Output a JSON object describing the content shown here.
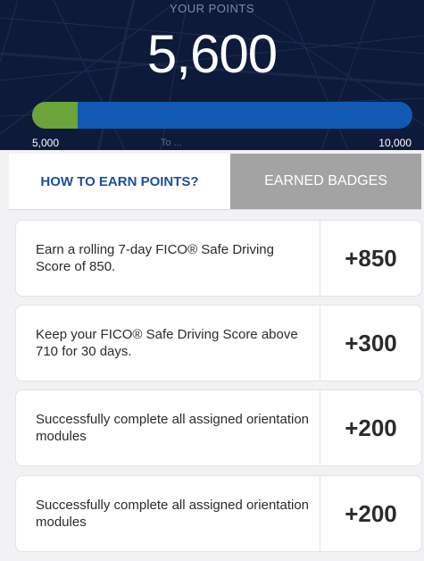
{
  "header": {
    "points_label": "YOUR POINTS",
    "points_value": "5,600",
    "progress": {
      "current": 5600,
      "min": 5000,
      "max": 10000
    },
    "scale_min": "5,000",
    "scale_max": "10,000",
    "scale_mid_text": "To ... ",
    "colors": {
      "background": "#0d1a3a",
      "track": "#1259b4",
      "fill": "#6aa43a"
    }
  },
  "tabs": {
    "earn_label": "HOW TO EARN POINTS?",
    "badges_label": "EARNED BADGES",
    "active": "earn"
  },
  "earn_items": [
    {
      "description": "Earn a rolling 7-day FICO® Safe Driving Score of 850.",
      "points": "+850"
    },
    {
      "description": "Keep your FICO® Safe Driving Score above 710 for 30 days.",
      "points": "+300"
    },
    {
      "description": "Successfully complete all assigned orientation modules",
      "points": "+200"
    },
    {
      "description": "Successfully complete all assigned orientation modules",
      "points": "+200"
    }
  ]
}
